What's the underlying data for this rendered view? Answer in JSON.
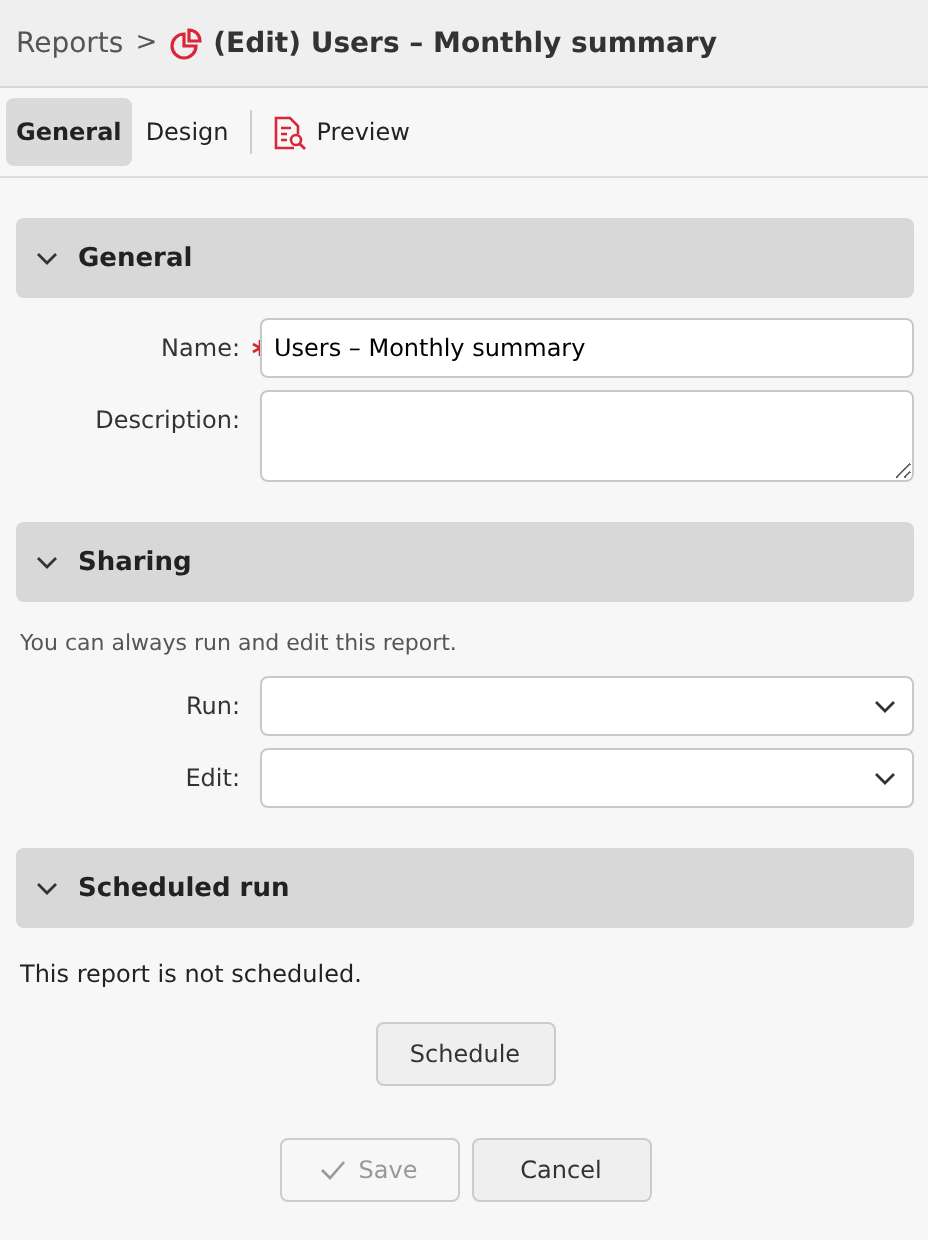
{
  "breadcrumb": {
    "parent": "Reports",
    "separator": ">",
    "title": "(Edit) Users – Monthly summary"
  },
  "tabs": [
    {
      "label": "General",
      "selected": true,
      "kind": "text"
    },
    {
      "label": "Design",
      "selected": false,
      "kind": "text"
    },
    {
      "label": "Preview",
      "selected": false,
      "kind": "icon"
    }
  ],
  "sections": [
    {
      "title": "General",
      "expanded": true,
      "kind": "fields",
      "fields": [
        {
          "label": "Name:",
          "required": true,
          "kind": "input",
          "value": "Users – Monthly summary"
        },
        {
          "label": "Description:",
          "required": false,
          "kind": "textarea"
        }
      ]
    },
    {
      "title": "Sharing",
      "expanded": true,
      "kind": "fields",
      "note": "You can always run and edit this report.",
      "fields": [
        {
          "label": "Run:",
          "required": false,
          "kind": "select"
        },
        {
          "label": "Edit:",
          "required": false,
          "kind": "select"
        }
      ]
    },
    {
      "title": "Scheduled run",
      "expanded": true,
      "kind": "schedule",
      "message": "This report is not scheduled.",
      "button": "Schedule"
    }
  ],
  "footer": {
    "save": {
      "label": "Save",
      "disabled": true
    },
    "cancel": {
      "label": "Cancel",
      "disabled": false
    }
  }
}
